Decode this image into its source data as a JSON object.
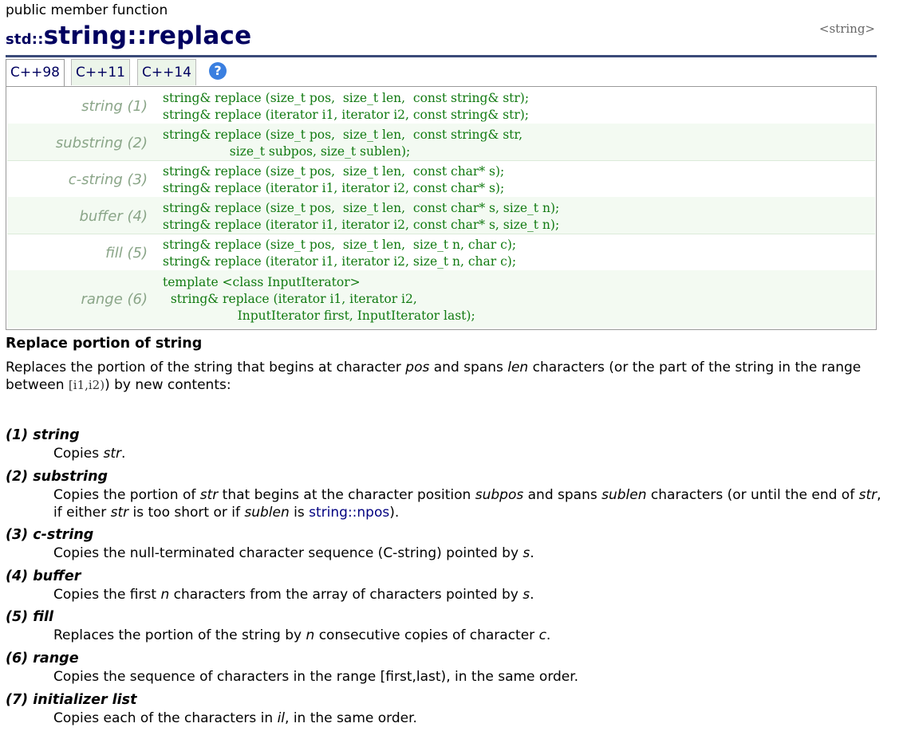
{
  "header": {
    "kicker": "public member function",
    "namespace": "std::",
    "title_name": "string::replace",
    "header_ref": "<string>"
  },
  "tabs": [
    {
      "label": "C++98",
      "active": true
    },
    {
      "label": "C++11",
      "active": false
    },
    {
      "label": "C++14",
      "active": false
    }
  ],
  "help_icon": "?",
  "prototypes": [
    {
      "label": "string (1)",
      "code": "string& replace (size_t pos,  size_t len,  const string& str);\nstring& replace (iterator i1, iterator i2, const string& str);"
    },
    {
      "label": "substring (2)",
      "code": "string& replace (size_t pos,  size_t len,  const string& str,\n                 size_t subpos, size_t sublen);"
    },
    {
      "label": "c-string (3)",
      "code": "string& replace (size_t pos,  size_t len,  const char* s);\nstring& replace (iterator i1, iterator i2, const char* s);"
    },
    {
      "label": "buffer (4)",
      "code": "string& replace (size_t pos,  size_t len,  const char* s, size_t n);\nstring& replace (iterator i1, iterator i2, const char* s, size_t n);"
    },
    {
      "label": "fill (5)",
      "code": "string& replace (size_t pos,  size_t len,  size_t n, char c);\nstring& replace (iterator i1, iterator i2, size_t n, char c);"
    },
    {
      "label": "range (6)",
      "code": "template <class InputIterator>\n  string& replace (iterator i1, iterator i2,\n                   InputIterator first, InputIterator last);"
    }
  ],
  "section_title": "Replace portion of string",
  "description": {
    "p1": "Replaces the portion of the string that begins at character ",
    "pos": "pos",
    "p2": " and spans ",
    "len": "len",
    "p3": " characters (or the part of the string in the range between ",
    "range_code": "[i1,i2)",
    "p4": ") by new contents:"
  },
  "items": [
    {
      "head": "(1) string",
      "parts": [
        "Copies ",
        "str",
        "."
      ]
    },
    {
      "head": "(2) substring",
      "parts": [
        "Copies the portion of ",
        "str",
        " that begins at the character position ",
        "subpos",
        " and spans ",
        "sublen",
        " characters (or until the end of ",
        "str",
        ", if either ",
        "str",
        " is too short or if ",
        "sublen",
        " is ",
        "string::npos",
        ")."
      ]
    },
    {
      "head": "(3) c-string",
      "parts": [
        "Copies the null-terminated character sequence (C-string) pointed by ",
        "s",
        "."
      ]
    },
    {
      "head": "(4) buffer",
      "parts": [
        "Copies the first ",
        "n",
        " characters from the array of characters pointed by ",
        "s",
        "."
      ]
    },
    {
      "head": "(5) fill",
      "parts": [
        "Replaces the portion of the string by ",
        "n",
        " consecutive copies of character ",
        "c",
        "."
      ]
    },
    {
      "head": "(6) range",
      "parts": [
        "Copies the sequence of characters in the range ",
        "[first,last)",
        ", in the same order."
      ]
    },
    {
      "head": "(7) initializer list",
      "parts": [
        "Copies each of the characters in ",
        "il",
        ", in the same order."
      ]
    }
  ]
}
